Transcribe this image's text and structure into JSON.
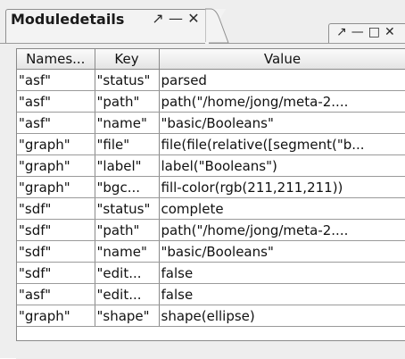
{
  "panel": {
    "title": "Moduledetails",
    "ctrl_pin": "↗",
    "ctrl_min": "—",
    "ctrl_close": "✕"
  },
  "second_panel": {
    "ctrl_pin": "↗",
    "ctrl_min": "—",
    "ctrl_max": "□",
    "ctrl_close": "✕"
  },
  "table": {
    "columns": [
      "Names...",
      "Key",
      "Value"
    ],
    "rows": [
      [
        "\"asf\"",
        "\"status\"",
        "parsed"
      ],
      [
        "\"asf\"",
        "\"path\"",
        "path(\"/home/jong/meta-2...."
      ],
      [
        "\"asf\"",
        "\"name\"",
        "\"basic/Booleans\""
      ],
      [
        "\"graph\"",
        "\"file\"",
        "file(file(relative([segment(\"b..."
      ],
      [
        "\"graph\"",
        "\"label\"",
        "label(\"Booleans\")"
      ],
      [
        "\"graph\"",
        "\"bgc...",
        "fill-color(rgb(211,211,211))"
      ],
      [
        "\"sdf\"",
        "\"status\"",
        "complete"
      ],
      [
        "\"sdf\"",
        "\"path\"",
        "path(\"/home/jong/meta-2...."
      ],
      [
        "\"sdf\"",
        "\"name\"",
        "\"basic/Booleans\""
      ],
      [
        "\"sdf\"",
        "\"edit...",
        "false"
      ],
      [
        "\"asf\"",
        "\"edit...",
        "false"
      ],
      [
        "\"graph\"",
        "\"shape\"",
        "shape(ellipse)"
      ]
    ]
  }
}
